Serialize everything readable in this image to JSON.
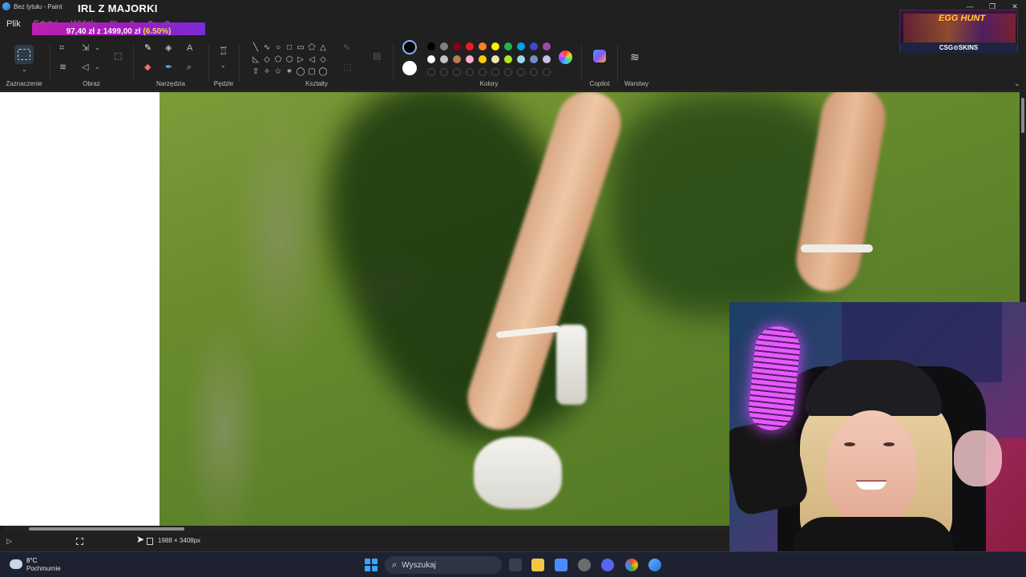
{
  "window": {
    "title": "Bez tytułu - Paint"
  },
  "menu": {
    "file": "Plik",
    "edit": "Edytuj",
    "view": "Widok"
  },
  "overlay": {
    "stream_title": "IRL Z MAJORKI",
    "donation_text": "97,40 zł z 1499,00 zł",
    "donation_percent": "(6.50%)",
    "donation_progress": 0.065
  },
  "ribbon": {
    "groups": {
      "selection": "Zaznaczenie",
      "image": "Obraz",
      "tools": "Narzędzia",
      "brushes": "Pędzle",
      "shapes": "Kształty",
      "colors": "Kolory",
      "copilot": "Copilot",
      "layers": "Warstwy"
    },
    "icons": {
      "shapes": [
        "╲",
        "∿",
        "○",
        "□",
        "▭",
        "⬠",
        "△",
        "◺",
        "◇",
        "⬠",
        "⬡",
        "▷",
        "◁",
        "◇",
        "⇧",
        "✧",
        "☆",
        "✶",
        "◯",
        "▢",
        "◯"
      ]
    },
    "colors": {
      "current_primary": "#000000",
      "current_secondary": "#ffffff",
      "palette": [
        "#000000",
        "#7f7f7f",
        "#880015",
        "#ed1c24",
        "#ff7f27",
        "#fff200",
        "#22b14c",
        "#00a2e8",
        "#3f48cc",
        "#a349a4",
        "#ffffff",
        "#c3c3c3",
        "#b97a57",
        "#ffaec9",
        "#ffc90e",
        "#efe4b0",
        "#b5e61d",
        "#99d9ea",
        "#7092be",
        "#c8bfe7"
      ]
    }
  },
  "status": {
    "image_size": "1988 × 3408px"
  },
  "sponsor": {
    "event": "EGG HUNT",
    "brand": "CSG⊙SKINS"
  },
  "taskbar": {
    "temperature": "8°C",
    "weather": "Pochmurnie",
    "search_placeholder": "Wyszukaj"
  }
}
